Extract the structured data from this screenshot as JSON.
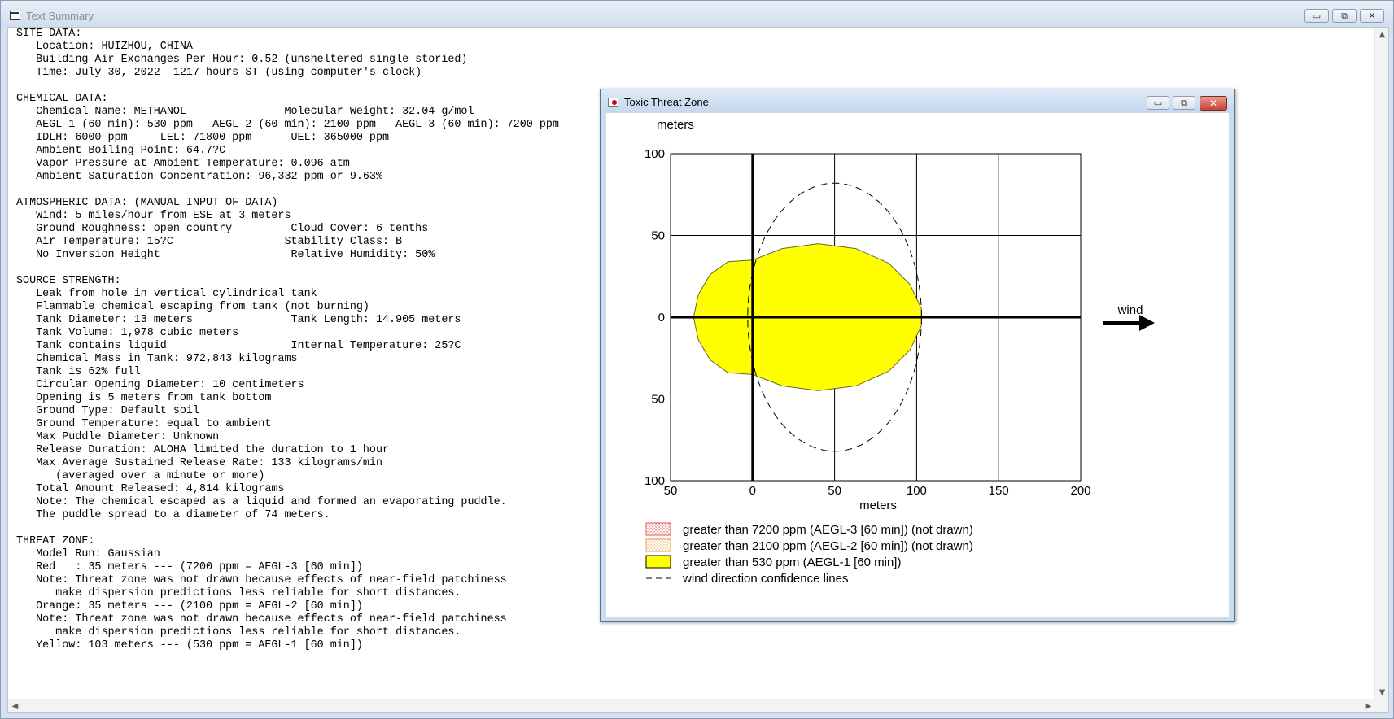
{
  "main_window": {
    "title": "Text Summary",
    "controls": {
      "minimize": "▭",
      "maximize": "⧉",
      "close": "✕"
    },
    "summary_lines": [
      "SITE DATA:",
      "   Location: HUIZHOU, CHINA",
      "   Building Air Exchanges Per Hour: 0.52 (unsheltered single storied)",
      "   Time: July 30, 2022  1217 hours ST (using computer's clock)",
      "",
      "CHEMICAL DATA:",
      "   Chemical Name: METHANOL               Molecular Weight: 32.04 g/mol",
      "   AEGL-1 (60 min): 530 ppm   AEGL-2 (60 min): 2100 ppm   AEGL-3 (60 min): 7200 ppm",
      "   IDLH: 6000 ppm     LEL: 71800 ppm      UEL: 365000 ppm",
      "   Ambient Boiling Point: 64.7?C",
      "   Vapor Pressure at Ambient Temperature: 0.096 atm",
      "   Ambient Saturation Concentration: 96,332 ppm or 9.63%",
      "",
      "ATMOSPHERIC DATA: (MANUAL INPUT OF DATA)",
      "   Wind: 5 miles/hour from ESE at 3 meters",
      "   Ground Roughness: open country         Cloud Cover: 6 tenths",
      "   Air Temperature: 15?C                 Stability Class: B",
      "   No Inversion Height                    Relative Humidity: 50%",
      "",
      "SOURCE STRENGTH:",
      "   Leak from hole in vertical cylindrical tank",
      "   Flammable chemical escaping from tank (not burning)",
      "   Tank Diameter: 13 meters               Tank Length: 14.905 meters",
      "   Tank Volume: 1,978 cubic meters",
      "   Tank contains liquid                   Internal Temperature: 25?C",
      "   Chemical Mass in Tank: 972,843 kilograms",
      "   Tank is 62% full",
      "   Circular Opening Diameter: 10 centimeters",
      "   Opening is 5 meters from tank bottom",
      "   Ground Type: Default soil",
      "   Ground Temperature: equal to ambient",
      "   Max Puddle Diameter: Unknown",
      "   Release Duration: ALOHA limited the duration to 1 hour",
      "   Max Average Sustained Release Rate: 133 kilograms/min",
      "      (averaged over a minute or more)",
      "   Total Amount Released: 4,814 kilograms",
      "   Note: The chemical escaped as a liquid and formed an evaporating puddle.",
      "   The puddle spread to a diameter of 74 meters.",
      "",
      "THREAT ZONE:",
      "   Model Run: Gaussian",
      "   Red   : 35 meters --- (7200 ppm = AEGL-3 [60 min])",
      "   Note: Threat zone was not drawn because effects of near-field patchiness",
      "      make dispersion predictions less reliable for short distances.",
      "   Orange: 35 meters --- (2100 ppm = AEGL-2 [60 min])",
      "   Note: Threat zone was not drawn because effects of near-field patchiness",
      "      make dispersion predictions less reliable for short distances.",
      "   Yellow: 103 meters --- (530 ppm = AEGL-1 [60 min])"
    ],
    "scrollbar": {
      "up": "▲",
      "down": "▼",
      "left": "◀",
      "right": "▶"
    }
  },
  "threat_window": {
    "title": "Toxic Threat Zone",
    "controls": {
      "minimize": "▭",
      "maximize": "⧉",
      "close": "✕"
    }
  },
  "chart_data": {
    "type": "area",
    "y_axis_title": "meters",
    "x_axis_title": "meters",
    "x_ticks": [
      "50",
      "0",
      "50",
      "100",
      "150",
      "200"
    ],
    "y_ticks": [
      "100",
      "50",
      "0",
      "50",
      "100"
    ],
    "xlim": [
      -50,
      200
    ],
    "ylim": [
      -100,
      100
    ],
    "grid": true,
    "wind_label": "wind",
    "footprint_aegl1": {
      "name": "greater than 530 ppm (AEGL-1 [60 min])",
      "color": "#ffff00",
      "outline": [
        [
          -36,
          0
        ],
        [
          -33,
          14
        ],
        [
          -26,
          26
        ],
        [
          -15,
          34
        ],
        [
          0,
          35
        ],
        [
          18,
          42
        ],
        [
          40,
          45
        ],
        [
          63,
          42
        ],
        [
          83,
          33
        ],
        [
          96,
          20
        ],
        [
          103,
          5
        ],
        [
          103,
          0
        ],
        [
          103,
          -5
        ],
        [
          96,
          -20
        ],
        [
          83,
          -33
        ],
        [
          63,
          -42
        ],
        [
          40,
          -45
        ],
        [
          18,
          -42
        ],
        [
          0,
          -35
        ],
        [
          -15,
          -34
        ],
        [
          -26,
          -26
        ],
        [
          -33,
          -14
        ],
        [
          -36,
          0
        ]
      ]
    },
    "confidence_lines": {
      "name": "wind direction confidence lines",
      "center_x": 50,
      "half_width": 53,
      "half_height": 82
    },
    "legend": [
      {
        "label": "greater than 7200 ppm (AEGL-3 [60 min]) (not drawn)",
        "swatch": "red-hatched"
      },
      {
        "label": "greater than 2100 ppm (AEGL-2 [60 min]) (not drawn)",
        "swatch": "orange-hatched"
      },
      {
        "label": "greater than 530 ppm (AEGL-1 [60 min])",
        "swatch": "yellow-solid"
      },
      {
        "label": "wind direction confidence lines",
        "swatch": "dashed-line"
      }
    ]
  }
}
